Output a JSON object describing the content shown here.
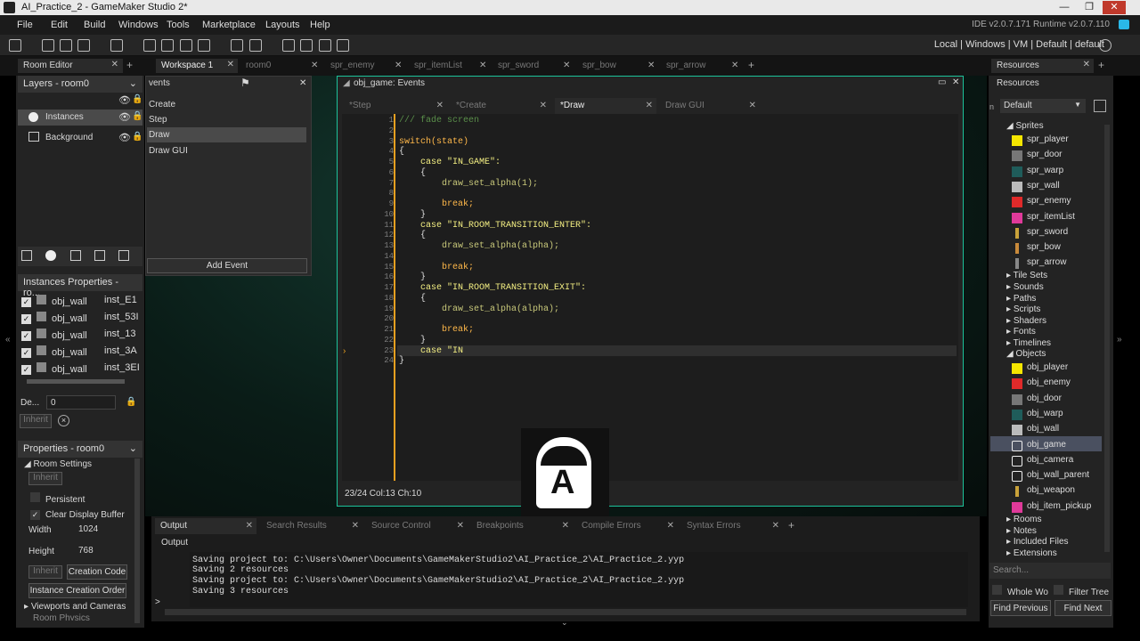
{
  "window": {
    "title": "AI_Practice_2 - GameMaker Studio 2*",
    "min": "—",
    "restore": "❐",
    "close": "✕"
  },
  "menu": [
    "File",
    "Edit",
    "Build",
    "Windows",
    "Tools",
    "Marketplace",
    "Layouts",
    "Help"
  ],
  "version": "IDE v2.0.7.171 Runtime v2.0.7.110",
  "target": "Local | Windows | VM | Default | default",
  "topTabs": {
    "room_editor": "Room Editor",
    "workspace": "Workspace 1",
    "room0": "room0",
    "spr_enemy": "spr_enemy",
    "spr_itemList": "spr_itemList",
    "spr_sword": "spr_sword",
    "spr_bow": "spr_bow",
    "spr_arrow": "spr_arrow",
    "resources": "Resources"
  },
  "layers": {
    "title": "Layers - room0",
    "items": [
      "Instances",
      "Background"
    ]
  },
  "instProps": {
    "title": "Instances Properties - ro...",
    "rows": [
      {
        "obj": "obj_wall",
        "inst": "inst_E1"
      },
      {
        "obj": "obj_wall",
        "inst": "inst_53I"
      },
      {
        "obj": "obj_wall",
        "inst": "inst_13"
      },
      {
        "obj": "obj_wall",
        "inst": "inst_3A"
      },
      {
        "obj": "obj_wall",
        "inst": "inst_3EI"
      }
    ]
  },
  "depth": {
    "label": "De...",
    "value": "0",
    "inherit": "Inherit"
  },
  "roomProps": {
    "title": "Properties - room0",
    "settings": "Room Settings",
    "inherit": "Inherit",
    "persistent": "Persistent",
    "clear": "Clear Display Buffer",
    "width_label": "Width",
    "width": "1024",
    "height_label": "Height",
    "height": "768",
    "inherit2": "Inherit",
    "creation_code": "Creation Code",
    "order": "Instance Creation Order",
    "viewports": "Viewports and Cameras",
    "physics": "Room Physics"
  },
  "events": {
    "title": "vents",
    "items": [
      "Create",
      "Step",
      "Draw",
      "Draw GUI"
    ],
    "add": "Add Event"
  },
  "editor": {
    "title": "obj_game: Events",
    "tabs": [
      "*Step",
      "*Create",
      "*Draw",
      "Draw GUI"
    ],
    "status": "23/24 Col:13 Ch:10"
  },
  "code": [
    {
      "n": "1",
      "t": "/// fade screen",
      "c": "cmt"
    },
    {
      "n": "2",
      "t": "",
      "c": "pn"
    },
    {
      "n": "3",
      "t": "switch(state)",
      "c": "kw"
    },
    {
      "n": "4",
      "t": "{",
      "c": "pn"
    },
    {
      "n": "5",
      "t": "    case \"IN_GAME\":",
      "c": "str"
    },
    {
      "n": "6",
      "t": "    {",
      "c": "pn"
    },
    {
      "n": "7",
      "t": "        draw_set_alpha(1);",
      "c": "fn"
    },
    {
      "n": "8",
      "t": "",
      "c": "pn"
    },
    {
      "n": "9",
      "t": "        break;",
      "c": "kw"
    },
    {
      "n": "10",
      "t": "    }",
      "c": "pn"
    },
    {
      "n": "11",
      "t": "    case \"IN_ROOM_TRANSITION_ENTER\":",
      "c": "str"
    },
    {
      "n": "12",
      "t": "    {",
      "c": "pn"
    },
    {
      "n": "13",
      "t": "        draw_set_alpha(alpha);",
      "c": "fn"
    },
    {
      "n": "14",
      "t": "",
      "c": "pn"
    },
    {
      "n": "15",
      "t": "        break;",
      "c": "kw"
    },
    {
      "n": "16",
      "t": "    }",
      "c": "pn"
    },
    {
      "n": "17",
      "t": "    case \"IN_ROOM_TRANSITION_EXIT\":",
      "c": "str"
    },
    {
      "n": "18",
      "t": "    {",
      "c": "pn"
    },
    {
      "n": "19",
      "t": "        draw_set_alpha(alpha);",
      "c": "fn"
    },
    {
      "n": "20",
      "t": "",
      "c": "pn"
    },
    {
      "n": "21",
      "t": "        break;",
      "c": "kw"
    },
    {
      "n": "22",
      "t": "    }",
      "c": "pn"
    },
    {
      "n": "23",
      "t": "    case \"IN",
      "c": "str"
    },
    {
      "n": "24",
      "t": "}",
      "c": "pn"
    }
  ],
  "overlayLetter": "A",
  "output": {
    "tabs": [
      "Output",
      "Search Results",
      "Source Control",
      "Breakpoints",
      "Compile Errors",
      "Syntax Errors"
    ],
    "sub": "Output",
    "lines": [
      "Saving project to: C:\\Users\\Owner\\Documents\\GameMakerStudio2\\AI_Practice_2\\AI_Practice_2.yyp",
      "Saving 2 resources",
      "Saving project to: C:\\Users\\Owner\\Documents\\GameMakerStudio2\\AI_Practice_2\\AI_Practice_2.yyp",
      "Saving 3 resources"
    ],
    "prompt": ">"
  },
  "resources": {
    "title": "Resources",
    "sub": "Resources",
    "filter": "Default",
    "sprites": "Sprites",
    "spriteItems": [
      "spr_player",
      "spr_door",
      "spr_warp",
      "spr_wall",
      "spr_enemy",
      "spr_itemList",
      "spr_sword",
      "spr_bow",
      "spr_arrow"
    ],
    "groups1": [
      "Tile Sets",
      "Sounds",
      "Paths",
      "Scripts",
      "Shaders",
      "Fonts",
      "Timelines"
    ],
    "objects": "Objects",
    "objectItems": [
      "obj_player",
      "obj_enemy",
      "obj_door",
      "obj_warp",
      "obj_wall",
      "obj_game",
      "obj_camera",
      "obj_wall_parent",
      "obj_weapon",
      "obj_item_pickup"
    ],
    "groups2": [
      "Rooms",
      "Notes",
      "Included Files",
      "Extensions"
    ],
    "search": "Search...",
    "whole": "Whole Wo",
    "filterTree": "Filter Tree",
    "prev": "Find Previous",
    "next": "Find Next"
  },
  "colors": {
    "spr_player": "#f5e600",
    "spr_door": "#777777",
    "spr_warp": "#1f5c5a",
    "spr_wall": "#bbbbbb",
    "spr_enemy": "#e02a2a",
    "spr_itemList": "#e03a9a",
    "spr_sword": "#c9a23a",
    "spr_bow": "#c98a3a",
    "spr_arrow": "#888888"
  }
}
